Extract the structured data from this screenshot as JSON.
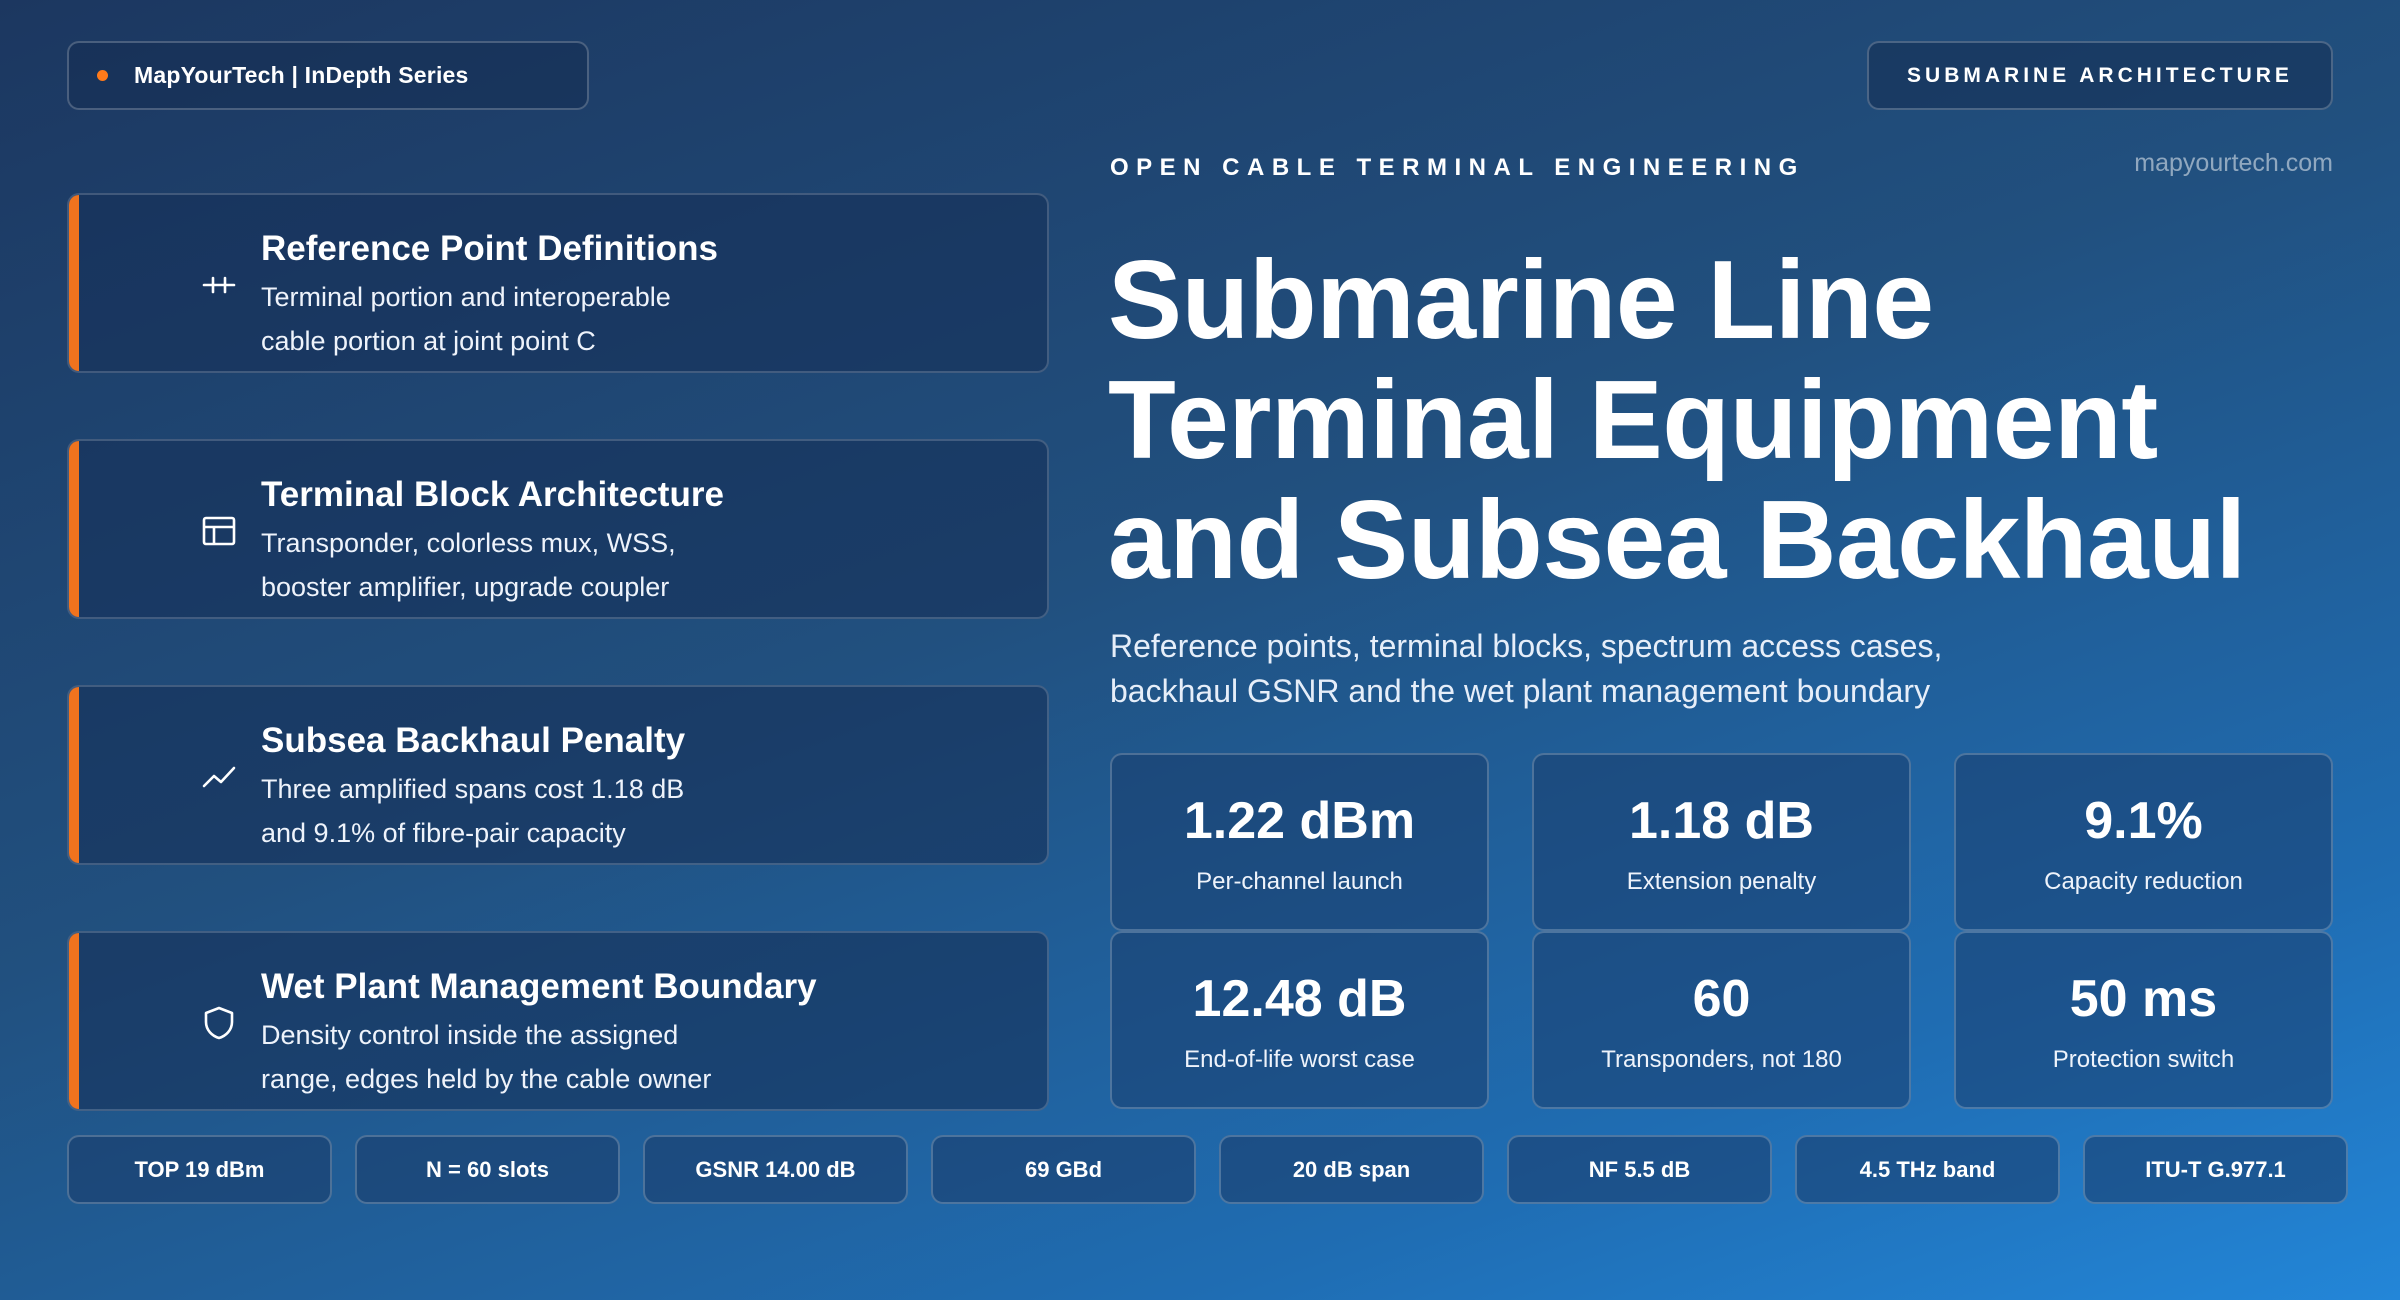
{
  "header": {
    "brand": "MapYourTech | InDepth Series",
    "section_badge": "SUBMARINE ARCHITECTURE",
    "eyebrow": "OPEN CABLE TERMINAL ENGINEERING",
    "site": "mapyourtech.com"
  },
  "hero": {
    "title_lines": [
      "Submarine Line",
      "Terminal Equipment",
      "and Subsea Backhaul"
    ],
    "subtitle_lines": [
      "Reference points, terminal blocks, spectrum access cases,",
      "backhaul GSNR and the wet plant management boundary"
    ]
  },
  "features": [
    {
      "icon": "reference-points-icon",
      "title": "Reference Point Definitions",
      "desc_lines": [
        "Terminal portion and interoperable",
        "cable portion at joint point C"
      ]
    },
    {
      "icon": "layout-block-icon",
      "title": "Terminal Block Architecture",
      "desc_lines": [
        "Transponder, colorless mux, WSS,",
        "booster amplifier, upgrade coupler"
      ]
    },
    {
      "icon": "trend-line-icon",
      "title": "Subsea Backhaul Penalty",
      "desc_lines": [
        "Three amplified spans cost 1.18 dB",
        "and 9.1% of fibre-pair capacity"
      ]
    },
    {
      "icon": "shield-icon",
      "title": "Wet Plant Management Boundary",
      "desc_lines": [
        "Density control inside the assigned",
        "range, edges held by the cable owner"
      ]
    }
  ],
  "stats": [
    {
      "value": "1.22 dBm",
      "label": "Per-channel launch"
    },
    {
      "value": "1.18 dB",
      "label": "Extension penalty"
    },
    {
      "value": "9.1%",
      "label": "Capacity reduction"
    },
    {
      "value": "12.48 dB",
      "label": "End-of-life worst case"
    },
    {
      "value": "60",
      "label": "Transponders, not 180"
    },
    {
      "value": "50 ms",
      "label": "Protection switch"
    }
  ],
  "chips": [
    "TOP 19 dBm",
    "N = 60 slots",
    "GSNR 14.00 dB",
    "69 GBd",
    "20 dB span",
    "NF 5.5 dB",
    "4.5 THz band",
    "ITU-T G.977.1"
  ],
  "colors": {
    "accent": "#f0731e",
    "brand_dot": "#ff7a1a",
    "background_top": "#1c3760",
    "background_bottom": "#2386d8"
  }
}
